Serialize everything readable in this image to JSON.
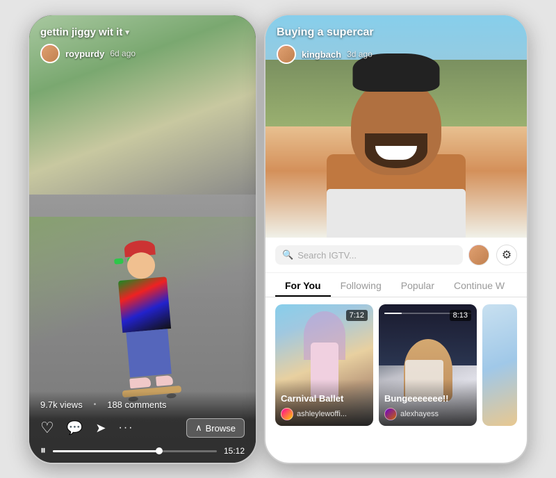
{
  "left_phone": {
    "video_title": "gettin jiggy wit it",
    "username": "roypurdy",
    "time_ago": "6d ago",
    "views": "9.7k views",
    "comments": "188 comments",
    "duration": "15:12",
    "browse_label": "Browse",
    "progress_percent": 65
  },
  "right_phone": {
    "igtv_title": "Buying a supercar",
    "username": "kingbach",
    "time_ago": "3d ago",
    "search_placeholder": "Search IGTV...",
    "tabs": [
      {
        "label": "For You",
        "active": true
      },
      {
        "label": "Following",
        "active": false
      },
      {
        "label": "Popular",
        "active": false
      },
      {
        "label": "Continue W",
        "active": false
      }
    ],
    "cards": [
      {
        "title": "Carnival Ballet",
        "username": "ashleylewoffi...",
        "duration": "7:12",
        "progress": 0
      },
      {
        "title": "Bungeeeeeee!!",
        "username": "alexhayess",
        "duration": "8:13",
        "progress": 20
      }
    ]
  }
}
